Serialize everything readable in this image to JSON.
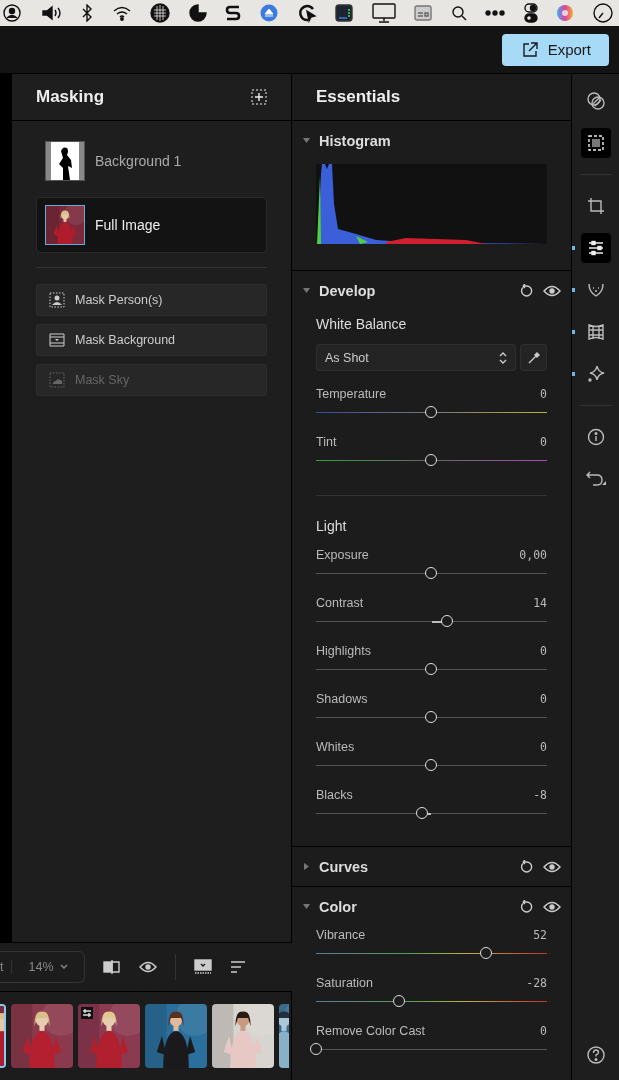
{
  "toolbar": {
    "export_button": "Export"
  },
  "masking": {
    "title": "Masking",
    "masks": [
      {
        "label": "Background 1",
        "kind": "silhouette",
        "selected": false
      },
      {
        "label": "Full Image",
        "kind": "picture",
        "selected": true
      }
    ],
    "actions": [
      {
        "label": "Mask Person(s)",
        "kind": "person",
        "disabled": false
      },
      {
        "label": "Mask Background",
        "kind": "background",
        "disabled": false
      },
      {
        "label": "Mask Sky",
        "kind": "sky",
        "disabled": true
      }
    ]
  },
  "view_bar": {
    "mode": "t",
    "zoom": "14%"
  },
  "filmstrip": [
    {
      "kind": "picture",
      "selected": true,
      "edited": false
    },
    {
      "kind": "picture",
      "selected": false,
      "edited": false
    },
    {
      "kind": "picture",
      "selected": false,
      "edited": true
    },
    {
      "kind": "picture",
      "selected": false,
      "edited": false
    },
    {
      "kind": "picture",
      "selected": false,
      "edited": false
    },
    {
      "kind": "picture",
      "selected": false,
      "edited": false
    }
  ],
  "essentials": {
    "title": "Essentials",
    "sections": [
      {
        "title": "Histogram",
        "kind": "histogram",
        "expanded": true
      },
      {
        "title": "Develop",
        "kind": "adjustment",
        "expanded": true,
        "groups": [
          {
            "title": "White Balance",
            "dropdown": "As Shot",
            "sliders": [
              {
                "label": "Temperature",
                "value": "0",
                "level": 0.5,
                "kind": "temperature"
              },
              {
                "label": "Tint",
                "value": "0",
                "level": 0.5,
                "kind": "tint"
              }
            ]
          },
          {
            "title": "Light",
            "sliders": [
              {
                "label": "Exposure",
                "value": "0,00",
                "level": 0.5,
                "kind": "neutral"
              },
              {
                "label": "Contrast",
                "value": "14",
                "level": 0.57,
                "kind": "neutral"
              },
              {
                "label": "Highlights",
                "value": "0",
                "level": 0.5,
                "kind": "neutral"
              },
              {
                "label": "Shadows",
                "value": "0",
                "level": 0.5,
                "kind": "neutral"
              },
              {
                "label": "Whites",
                "value": "0",
                "level": 0.5,
                "kind": "neutral"
              },
              {
                "label": "Blacks",
                "value": "-8",
                "level": 0.46,
                "kind": "neutral"
              }
            ]
          }
        ]
      },
      {
        "title": "Curves",
        "kind": "adjustment",
        "expanded": false
      },
      {
        "title": "Color",
        "kind": "adjustment",
        "expanded": true,
        "groups": [
          {
            "sliders": [
              {
                "label": "Vibrance",
                "value": "52",
                "level": 0.74,
                "kind": "spectrum"
              },
              {
                "label": "Saturation",
                "value": "-28",
                "level": 0.36,
                "kind": "spectrum"
              },
              {
                "label": "Remove Color Cast",
                "value": "0",
                "level": 0,
                "kind": "plain"
              }
            ]
          }
        ]
      }
    ]
  },
  "tool_rail": [
    {
      "kind": "masks",
      "selected": false,
      "edited": false
    },
    {
      "kind": "masking",
      "selected": true,
      "edited": false
    },
    {
      "kind": "divider"
    },
    {
      "kind": "crop",
      "selected": false,
      "edited": false
    },
    {
      "kind": "adjust",
      "selected": true,
      "edited": true
    },
    {
      "kind": "face",
      "selected": false,
      "edited": true
    },
    {
      "kind": "warp",
      "selected": false,
      "edited": true
    },
    {
      "kind": "sparkle",
      "selected": false,
      "edited": true
    },
    {
      "kind": "divider"
    },
    {
      "kind": "info",
      "selected": false,
      "edited": false
    },
    {
      "kind": "undo",
      "selected": false,
      "edited": false
    }
  ]
}
